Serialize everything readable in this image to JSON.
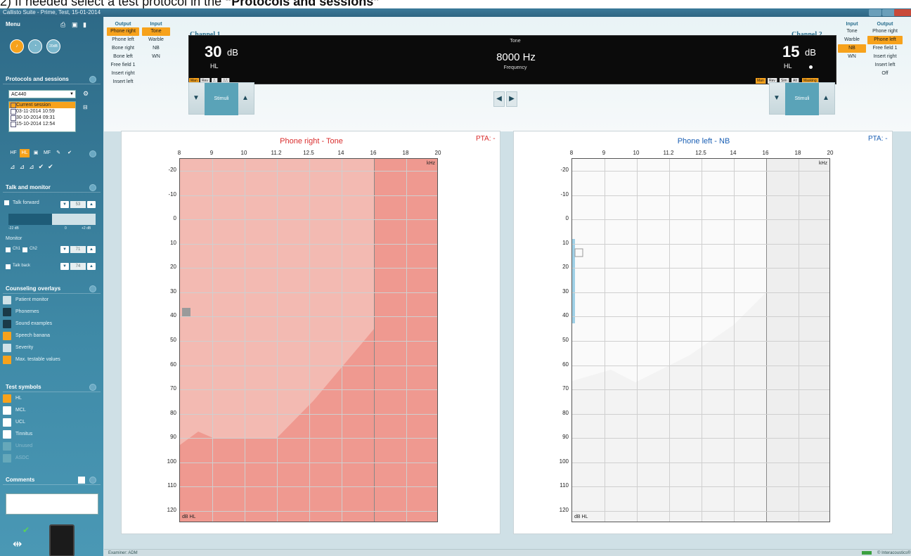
{
  "caption": {
    "prefix": "2)      If needed select a test protocol in the ",
    "bold": "“Protocols and sessions”"
  },
  "window": {
    "title": "Callisto Suite - Prime, Test, 15-01-2014"
  },
  "sidebar": {
    "menu_label": "Menu",
    "protocols": {
      "title": "Protocols and sessions",
      "selected_protocol": "AC440",
      "sessions": [
        "Current session",
        "03-11-2014 10:59",
        "30-10-2014 09:31",
        "15-10-2014 12:54"
      ]
    },
    "tools_row1": [
      "HF",
      "HL",
      "▣",
      "MF",
      "✎",
      "✔"
    ],
    "talk_monitor": {
      "title": "Talk and monitor",
      "talk_forward": "Talk forward",
      "talk_forward_value": "53",
      "range_min": "-22 dB",
      "range_mid": "0",
      "range_max": "+2 dB",
      "monitor_label": "Monitor",
      "ch1": "Ch1",
      "ch2": "Ch2",
      "monitor_value": "71",
      "talk_back": "Talk back",
      "talk_back_value": "74"
    },
    "counseling": {
      "title": "Counseling overlays",
      "items": [
        "Patient monitor",
        "Phonemes",
        "Sound examples",
        "Speech banana",
        "Severity",
        "Max. testable values"
      ]
    },
    "test_symbols": {
      "title": "Test symbols",
      "items": [
        "HL",
        "MCL",
        "UCL",
        "Tinnitus",
        "Unused",
        "ASDC"
      ]
    },
    "comments_title": "Comments"
  },
  "channel1": {
    "label": "Channel 1",
    "output_header": "Output",
    "input_header": "Input",
    "outputs": [
      "Phone right",
      "Phone left",
      "Bone right",
      "Bone left",
      "Free field 1",
      "Insert right",
      "Insert left"
    ],
    "active_output": "Phone right",
    "inputs": [
      "Tone",
      "Warble",
      "NB",
      "WN"
    ],
    "active_input": "Tone",
    "level": "30",
    "unit": "dB",
    "hl": "HL",
    "tags": [
      "Man",
      "Rev",
      "⎍",
      "⎍⎍"
    ],
    "stimuli": "Stimuli"
  },
  "channel2": {
    "label": "Channel 2",
    "output_header": "Output",
    "input_header": "Input",
    "outputs": [
      "Phone right",
      "Phone left",
      "Free field 1",
      "Insert right",
      "Insert left",
      "Off"
    ],
    "active_output": "Phone left",
    "inputs": [
      "Tone",
      "Warble",
      "NB",
      "WN"
    ],
    "active_input": "NB",
    "level": "15",
    "unit": "dB",
    "hl": "HL",
    "tags": [
      "Man",
      "Rev",
      "Sim",
      "Alt",
      "Masking"
    ],
    "stimuli": "Stimuli"
  },
  "center_display": {
    "type": "Tone",
    "frequency": "8000 Hz",
    "frequency_label": "Frequency"
  },
  "graph_right": {
    "title": "Phone right - Tone",
    "pta_label": "PTA:",
    "pta_value": "-",
    "x_ticks": [
      "8",
      "9",
      "10",
      "11.2",
      "12.5",
      "14",
      "16",
      "18",
      "20"
    ],
    "y_ticks": [
      "-20",
      "-10",
      "0",
      "10",
      "20",
      "30",
      "40",
      "50",
      "60",
      "70",
      "80",
      "90",
      "100",
      "110",
      "120"
    ],
    "x_unit": "kHz",
    "y_unit": "dB HL",
    "color": "#d92c2c"
  },
  "graph_left": {
    "title": "Phone left - NB",
    "pta_label": "PTA:",
    "pta_value": "-",
    "x_ticks": [
      "8",
      "9",
      "10",
      "11.2",
      "12.5",
      "14",
      "16",
      "18",
      "20"
    ],
    "y_ticks": [
      "-20",
      "-10",
      "0",
      "10",
      "20",
      "30",
      "40",
      "50",
      "60",
      "70",
      "80",
      "90",
      "100",
      "110",
      "120"
    ],
    "x_unit": "kHz",
    "y_unit": "dB HL",
    "color": "#1a5fb4"
  },
  "status": {
    "examiner": "Examiner: ADM",
    "brand": "© Interacoustics®"
  }
}
